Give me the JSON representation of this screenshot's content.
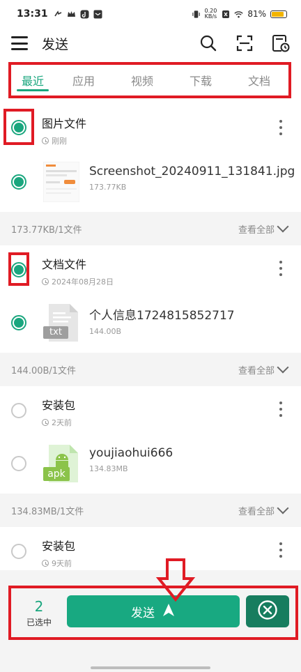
{
  "status": {
    "time": "13:31",
    "speed_value": "0.20",
    "speed_unit": "KB/s",
    "battery": "81%"
  },
  "app_bar": {
    "title": "发送"
  },
  "tabs": [
    {
      "label": "最近",
      "active": true
    },
    {
      "label": "应用",
      "active": false
    },
    {
      "label": "视频",
      "active": false
    },
    {
      "label": "下载",
      "active": false
    },
    {
      "label": "文档",
      "active": false
    }
  ],
  "groups": {
    "images": {
      "title": "图片文件",
      "time": "刚刚",
      "checked": true,
      "file_name": "Screenshot_20240911_131841.jpg",
      "file_size": "173.77KB",
      "summary": "173.77KB/1文件"
    },
    "docs": {
      "title": "文档文件",
      "time": "2024年08月28日",
      "checked": true,
      "file_name": "个人信息1724815852717",
      "file_size": "144.00B",
      "file_ext": "txt",
      "summary": "144.00B/1文件"
    },
    "apk1": {
      "title": "安装包",
      "time": "2天前",
      "checked": false,
      "file_name": "youjiaohui666",
      "file_size": "134.83MB",
      "file_ext": "apk",
      "summary": "134.83MB/1文件"
    },
    "apk2": {
      "title": "安装包",
      "time": "9天前",
      "checked": false
    }
  },
  "view_all_label": "查看全部",
  "bottom": {
    "selected_count": "2",
    "selected_label": "已选中",
    "send_label": "发送"
  },
  "colors": {
    "accent": "#1aa67e",
    "annotation_red": "#e01b24"
  }
}
